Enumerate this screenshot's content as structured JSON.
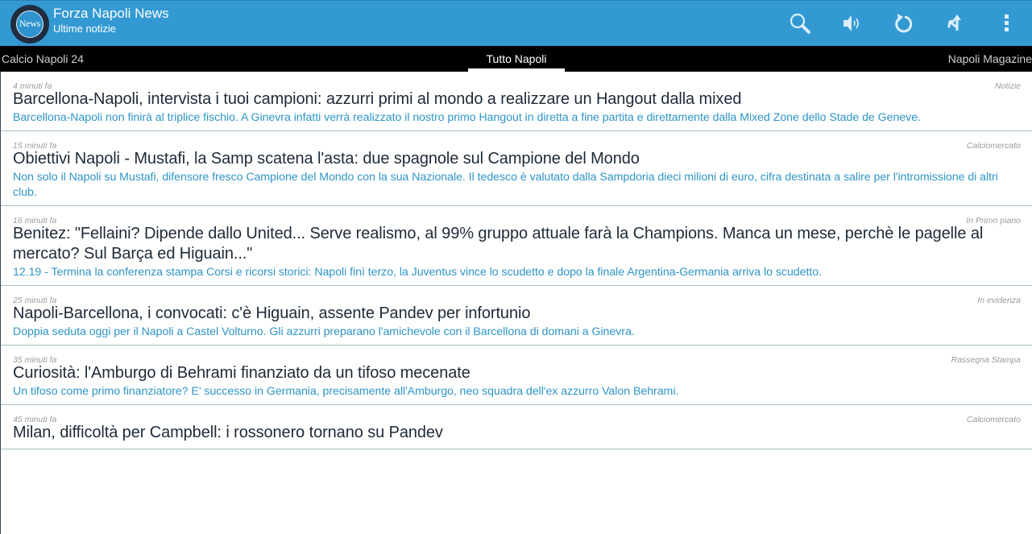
{
  "app": {
    "logo_text": "News",
    "title": "Forza Napoli News",
    "subtitle": "Ultime notizie",
    "actions": [
      {
        "name": "search",
        "icon": "search-icon"
      },
      {
        "name": "text-to-speech",
        "icon": "speaker-icon"
      },
      {
        "name": "refresh",
        "icon": "refresh-icon"
      },
      {
        "name": "share",
        "icon": "share-icon"
      },
      {
        "name": "overflow-menu",
        "icon": "more-vertical-icon"
      }
    ]
  },
  "tabs": [
    {
      "label": "Calcio Napoli 24",
      "active": false
    },
    {
      "label": "Tutto Napoli",
      "active": true
    },
    {
      "label": "Napoli Magazine",
      "active": false
    }
  ],
  "colors": {
    "appbar": "#3399d3",
    "tabbar": "#000000",
    "title": "#1e2a38",
    "summary": "#2f95c6",
    "meta": "#9a9a9a"
  },
  "articles": [
    {
      "time": "4 minuti fa",
      "category": "Notizie",
      "title": "Barcellona-Napoli, intervista i tuoi campioni: azzurri primi al mondo a realizzare un Hangout dalla mixed",
      "summary": "Barcellona-Napoli non finirà al triplice fischio. A Ginevra infatti verrà realizzato il nostro primo Hangout in diretta a fine partita e direttamente dalla Mixed Zone dello Stade de Geneve."
    },
    {
      "time": "15 minuti fa",
      "category": "Calciomercato",
      "title": "Obiettivi Napoli - Mustafi, la Samp scatena l'asta: due spagnole sul Campione del Mondo",
      "summary": "Non solo il Napoli su Mustafi, difensore fresco Campione del Mondo con la sua Nazionale. Il tedesco è valutato dalla Sampdoria dieci milioni di euro, cifra destinata a salire per l'intromissione di altri club."
    },
    {
      "time": "16 minuti fa",
      "category": "In Primo piano",
      "title": "Benitez: \"Fellaini? Dipende dallo United... Serve realismo, al 99% gruppo attuale farà la Champions. Manca un mese, perchè le pagelle al mercato? Sul Barça ed Higuain...\"",
      "summary": "12.19 - Termina la conferenza stampa Corsi e ricorsi storici: Napoli finì terzo, la Juventus vince lo scudetto e dopo la finale Argentina-Germania arriva lo scudetto."
    },
    {
      "time": "25 minuti fa",
      "category": "In evidenza",
      "title": "Napoli-Barcellona, i convocati: c'è Higuain, assente Pandev per infortunio",
      "summary": "Doppia seduta oggi per il Napoli a Castel Volturno. Gli azzurri preparano l'amichevole con il Barcellona di domani a Ginevra."
    },
    {
      "time": "35 minuti fa",
      "category": "Rassegna Stampa",
      "title": "Curiosità: l'Amburgo di Behrami finanziato da un tifoso mecenate",
      "summary": "Un tifoso come primo finanziatore? E' successo in Germania, precisamente all'Amburgo, neo squadra dell'ex azzurro Valon Behrami."
    },
    {
      "time": "45 minuti fa",
      "category": "Calciomercato",
      "title": "Milan, difficoltà per Campbell: i rossonero tornano su Pandev",
      "summary": ""
    }
  ]
}
